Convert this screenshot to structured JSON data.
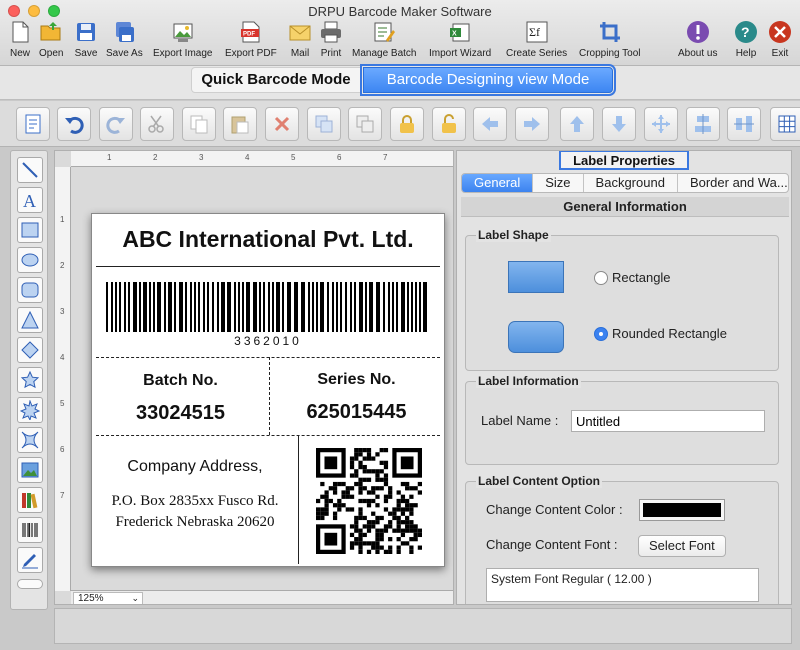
{
  "window": {
    "title": "DRPU Barcode Maker Software",
    "traffic_colors": [
      "#fc605c",
      "#fdbc40",
      "#34c84a"
    ]
  },
  "toolbar": {
    "items": [
      {
        "label": "New",
        "icon": "new-document-icon"
      },
      {
        "label": "Open",
        "icon": "open-folder-icon"
      },
      {
        "label": "Save",
        "icon": "save-disk-icon"
      },
      {
        "label": "Save As",
        "icon": "save-as-icon"
      },
      {
        "label": "Export Image",
        "icon": "export-image-icon"
      },
      {
        "label": "Export PDF",
        "icon": "export-pdf-icon"
      },
      {
        "label": "Mail",
        "icon": "mail-icon"
      },
      {
        "label": "Print",
        "icon": "printer-icon"
      },
      {
        "label": "Manage Batch",
        "icon": "manage-batch-icon"
      },
      {
        "label": "Import Wizard",
        "icon": "import-wizard-icon"
      },
      {
        "label": "Create Series",
        "icon": "create-series-icon"
      },
      {
        "label": "Cropping Tool",
        "icon": "cropping-tool-icon"
      },
      {
        "label": "About us",
        "icon": "about-icon"
      },
      {
        "label": "Help",
        "icon": "help-icon"
      },
      {
        "label": "Exit",
        "icon": "exit-icon"
      }
    ]
  },
  "modes": {
    "quick": "Quick Barcode Mode",
    "design": "Barcode Designing view Mode"
  },
  "canvas": {
    "zoom": "125%",
    "ruler_top": [
      "1",
      "2",
      "3",
      "4",
      "5",
      "6",
      "7"
    ],
    "ruler_left": [
      "1",
      "2",
      "3",
      "4",
      "5",
      "6",
      "7"
    ]
  },
  "label": {
    "company": "ABC International Pvt. Ltd.",
    "barcode_number": "3362010",
    "batch_label": "Batch No.",
    "batch_value": "33024515",
    "series_label": "Series No.",
    "series_value": "625015445",
    "address_title": "Company Address,",
    "address_line1": "P.O. Box 2835xx Fusco Rd.",
    "address_line2": "Frederick Nebraska 20620"
  },
  "properties": {
    "title": "Label Properties",
    "tabs": [
      "General",
      "Size",
      "Background",
      "Border and Wa..."
    ],
    "section": "General Information",
    "label_shape": {
      "title": "Label Shape",
      "options": [
        "Rectangle",
        "Rounded Rectangle"
      ],
      "selected": "Rounded Rectangle"
    },
    "label_information": {
      "title": "Label Information",
      "name_label": "Label Name :",
      "name_value": "Untitled"
    },
    "content_option": {
      "title": "Label Content Option",
      "color_label": "Change Content Color :",
      "color_value": "#000000",
      "font_label": "Change Content Font :",
      "font_button": "Select Font",
      "font_value": "System Font Regular  ( 12.00 )"
    }
  }
}
